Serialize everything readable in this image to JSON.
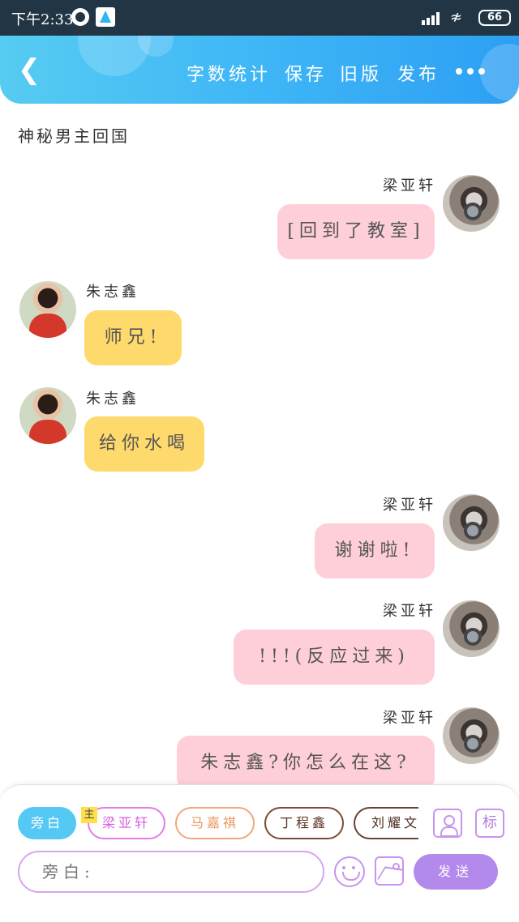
{
  "status_bar": {
    "time": "下午2:33",
    "battery": "66"
  },
  "header": {
    "links": [
      "字数统计",
      "保存",
      "旧版",
      "发布"
    ]
  },
  "document": {
    "title": "神秘男主回国"
  },
  "messages": [
    {
      "side": "right",
      "speaker": "梁亚轩",
      "text": "[回到了教室]",
      "color": "#fecfd9"
    },
    {
      "side": "left",
      "speaker": "朱志鑫",
      "text": "师兄!",
      "color": "#fed96b"
    },
    {
      "side": "left",
      "speaker": "朱志鑫",
      "text": "给你水喝",
      "color": "#fed96b"
    },
    {
      "side": "right",
      "speaker": "梁亚轩",
      "text": "谢谢啦!",
      "color": "#fecfd9"
    },
    {
      "side": "right",
      "speaker": "梁亚轩",
      "text": "!!!(反应过来)",
      "color": "#fecfd9"
    },
    {
      "side": "right",
      "speaker": "梁亚轩",
      "text": "朱志鑫?你怎么在这?",
      "color": "#fecfd9"
    }
  ],
  "roles": {
    "narrator": "旁白",
    "main_tag": "主",
    "characters": [
      "梁亚轩",
      "马嘉祺",
      "丁程鑫",
      "刘耀文"
    ]
  },
  "tools": {
    "tag_label": "标"
  },
  "composer": {
    "placeholder": "旁白:",
    "send_label": "发送"
  },
  "colors": {
    "header_gradient_start": "#56ccf2",
    "header_gradient_end": "#2d9ff3",
    "right_bubble": "#fecfd9",
    "left_bubble": "#fed96b",
    "send_button": "#b489ec",
    "narrator_chip": "#55c9f3"
  },
  "icons": [
    "back-arrow-icon",
    "more-dots-icon",
    "contact-icon",
    "emoji-icon",
    "image-icon",
    "wifi-icon",
    "signal-icon",
    "battery-icon"
  ]
}
